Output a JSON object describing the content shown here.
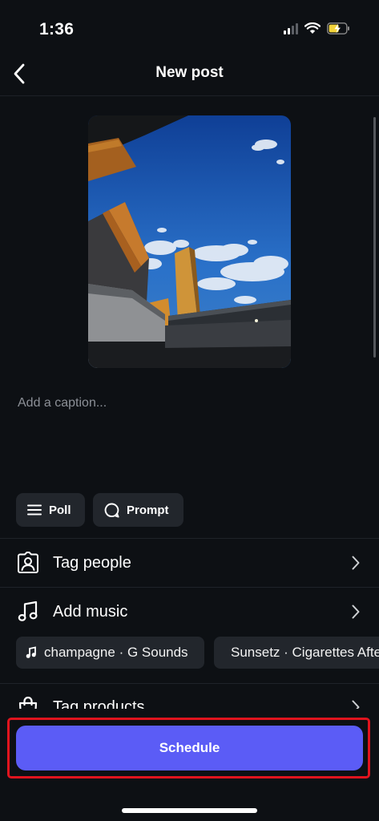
{
  "status_bar": {
    "time": "1:36"
  },
  "header": {
    "title": "New post"
  },
  "caption": {
    "placeholder": "Add a caption..."
  },
  "chips": {
    "poll": "Poll",
    "prompt": "Prompt"
  },
  "rows": {
    "tag_people": "Tag people",
    "add_music": "Add music",
    "tag_products": "Tag products"
  },
  "music_suggestions": [
    {
      "label": "champagne · G Sounds"
    },
    {
      "label": "Sunsetz · Cigarettes After Sex"
    }
  ],
  "schedule_button": {
    "label": "Schedule"
  },
  "colors": {
    "accent": "#5b5cf6",
    "highlight": "#e0141e",
    "background": "#0d1014"
  }
}
